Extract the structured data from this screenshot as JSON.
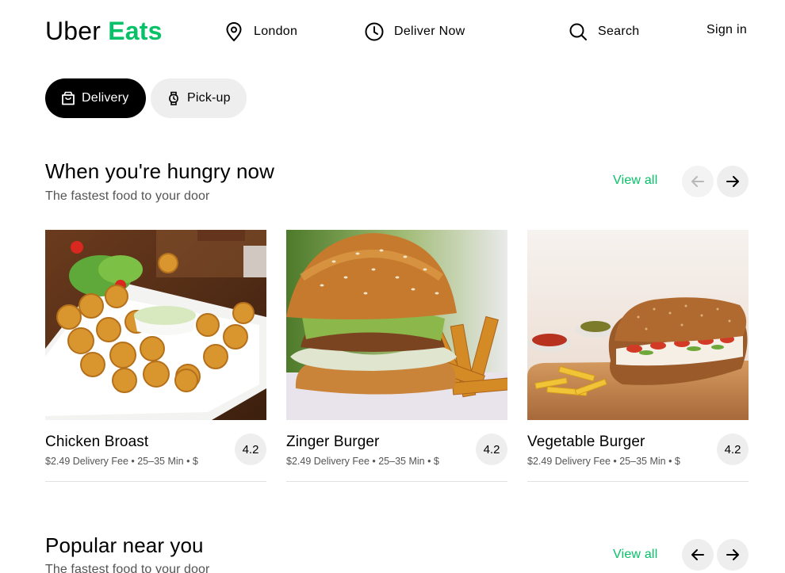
{
  "header": {
    "logo_primary": "Uber",
    "logo_accent": "Eats",
    "location_label": "London",
    "time_label": "Deliver Now",
    "search_label": "Search",
    "signin_label": "Sign in"
  },
  "modes": {
    "delivery_label": "Delivery",
    "pickup_label": "Pick-up",
    "selected": "Delivery"
  },
  "sections": [
    {
      "title": "When you're hungry now",
      "subtitle": "The fastest food to your door",
      "view_all": "View all",
      "prev_enabled": false,
      "next_enabled": true
    },
    {
      "title": "Popular near you",
      "subtitle": "The fastest food to your door",
      "view_all": "View all",
      "prev_enabled": true,
      "next_enabled": true
    }
  ],
  "cards": [
    {
      "name": "Chicken Broast",
      "meta": "$2.49 Delivery Fee • 25–35 Min • $",
      "rating": "4.2",
      "image": "fried-chicken-plate-photo"
    },
    {
      "name": "Zinger Burger",
      "meta": "$2.49 Delivery Fee • 25–35 Min • $",
      "rating": "4.2",
      "image": "burger-with-fries-photo"
    },
    {
      "name": "Vegetable Burger",
      "meta": "$2.49 Delivery Fee • 25–35 Min • $",
      "rating": "4.2",
      "image": "veg-sub-sandwich-photo"
    }
  ],
  "colors": {
    "brand_green": "#06c167",
    "chip_bg": "#eeeeee",
    "text_secondary": "#545454"
  }
}
